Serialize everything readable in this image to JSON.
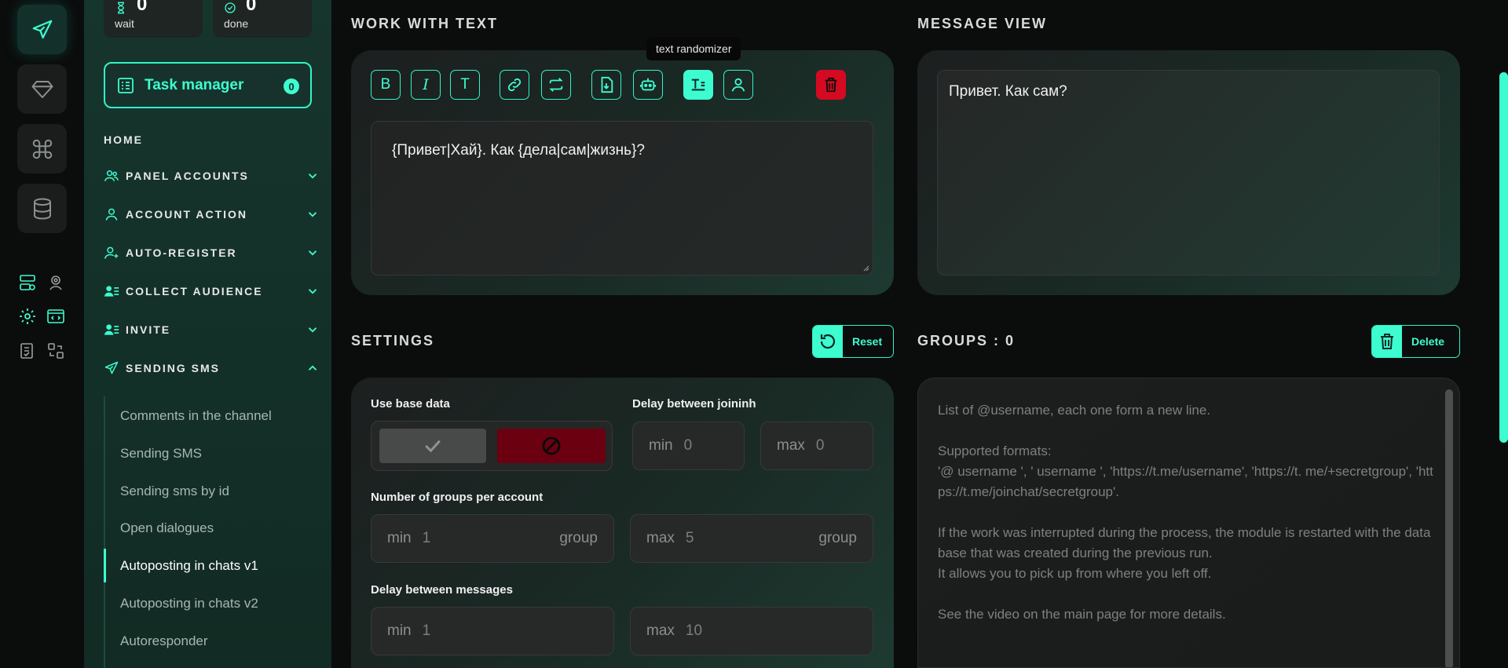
{
  "colors": {
    "accent": "#3dfdd0",
    "danger": "#d40a22"
  },
  "rail": {
    "icons": [
      "send-icon",
      "diamond-icon",
      "command-icon",
      "database-icon",
      "server-icon",
      "user-pin-icon",
      "gear-icon",
      "code-window-icon",
      "checklist-icon",
      "swap-icon"
    ]
  },
  "stats": [
    {
      "value": "0",
      "label": "wait",
      "icon": "hourglass-icon"
    },
    {
      "value": "0",
      "label": "done",
      "icon": "check-circle-icon"
    }
  ],
  "task_manager": {
    "label": "Task manager",
    "count": "0"
  },
  "nav": {
    "home": "HOME",
    "items": [
      {
        "label": "PANEL ACCOUNTS",
        "icon": "users-icon"
      },
      {
        "label": "ACCOUNT ACTION",
        "icon": "user-icon"
      },
      {
        "label": "AUTO-REGISTER",
        "icon": "user-plus-icon"
      },
      {
        "label": "COLLECT AUDIENCE",
        "icon": "user-list-icon"
      },
      {
        "label": "INVITE",
        "icon": "user-list-icon"
      },
      {
        "label": "SENDING SMS",
        "icon": "send-icon",
        "expanded": true
      }
    ],
    "sub_items": [
      "Comments in the channel",
      "Sending SMS",
      "Sending sms by id",
      "Open dialogues",
      "Autoposting in chats v1",
      "Autoposting in chats v2",
      "Autoresponder"
    ],
    "active_sub": "Autoposting in chats v1"
  },
  "work_with_text": {
    "title": "WORK WITH TEXT",
    "toolbar": [
      "B",
      "I",
      "T"
    ],
    "tooltip": "text randomizer",
    "text": "{Привет|Хай}. Как {дела|сам|жизнь}?"
  },
  "message_view": {
    "title": "MESSAGE VIEW",
    "text": "Привет. Как сам?"
  },
  "settings": {
    "title": "SETTINGS",
    "reset_label": "Reset",
    "use_base_data": "Use base data",
    "delay_joining": {
      "label": "Delay between joininh",
      "min_label": "min",
      "min": "0",
      "max_label": "max",
      "max": "0"
    },
    "groups_per_account": {
      "label": "Number of groups per account",
      "min_label": "min",
      "min": "1",
      "max_label": "max",
      "max": "5",
      "unit": "group"
    },
    "delay_messages": {
      "label": "Delay between messages",
      "min_label": "min",
      "min": "1",
      "max_label": "max",
      "max": "10"
    }
  },
  "groups": {
    "title": "GROUPS : 0",
    "delete_label": "Delete",
    "placeholder": "List of @username, each one form a new line.\n\nSupported formats:\n'@ username ', ' username ', 'https://t.me/username', 'https://t. me/+secretgroup', 'https://t.me/joinchat/secretgroup'.\n\nIf the work was interrupted during the process, the module is restarted with the database that was created during the previous run.\nIt allows you to pick up from where you left off.\n\nSee the video on the main page for more details."
  }
}
